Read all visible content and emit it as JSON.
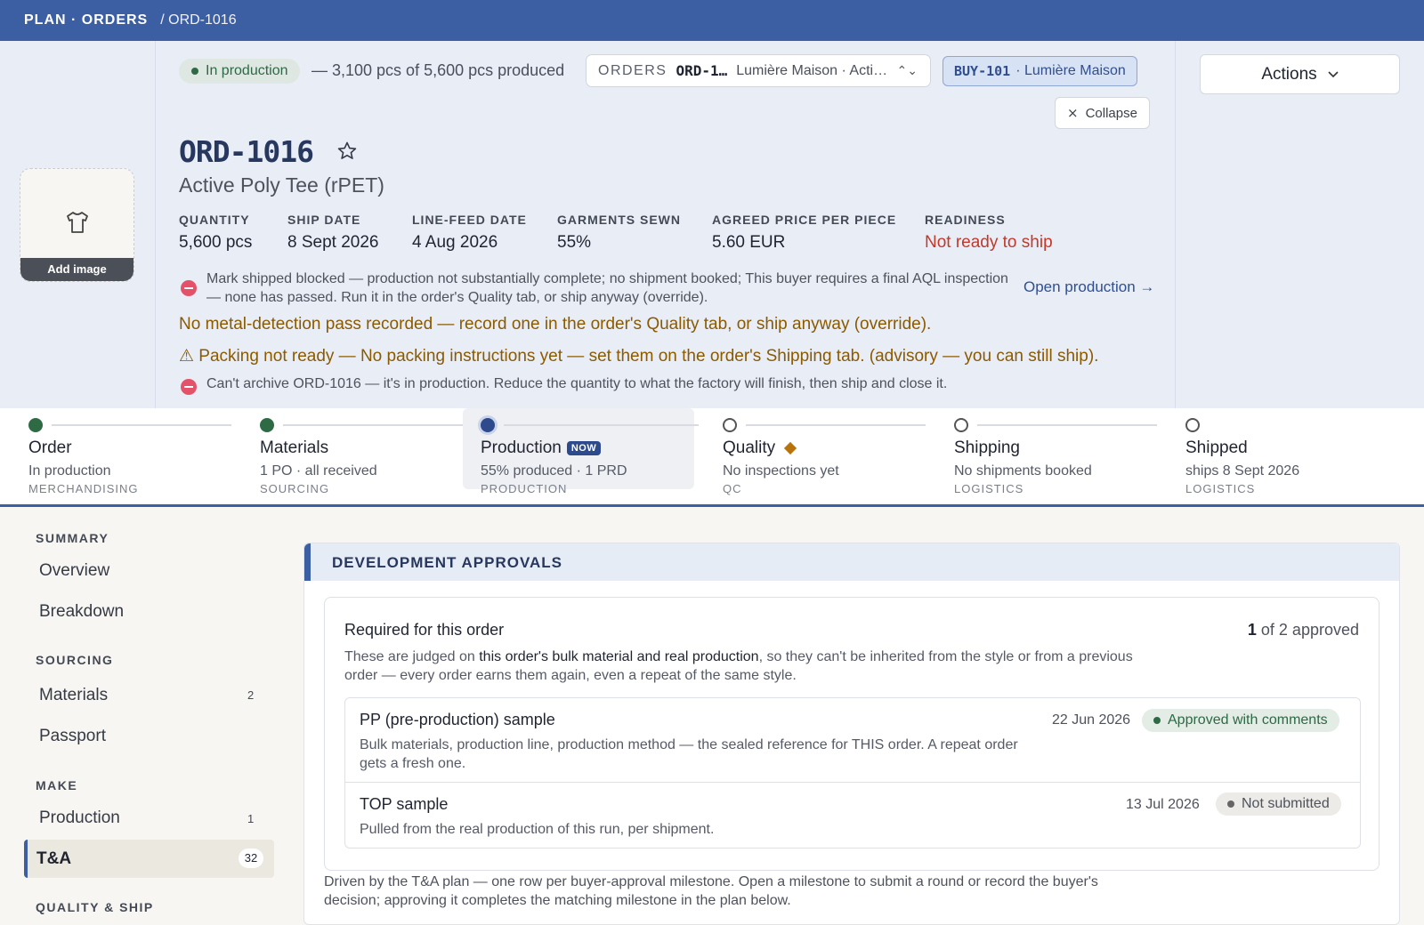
{
  "topbar": {
    "crumb1": "PLAN · ORDERS",
    "crumb2": "/ ORD-1016"
  },
  "header": {
    "status_pill": "In production",
    "produced_text": "— 3,100 pcs of 5,600 pcs produced",
    "orders_label": "ORDERS",
    "orders_code": "ORD-1…",
    "orders_who": "Lumière Maison · Acti…",
    "buyer_code": "BUY-101",
    "buyer_name": "· Lumière Maison",
    "collapse_label": "Collapse",
    "actions_label": "Actions",
    "add_image": "Add image",
    "order_id": "ORD-1016",
    "product": "Active Poly Tee (rPET)",
    "metrics": [
      {
        "k": "QUANTITY",
        "v": "5,600 pcs"
      },
      {
        "k": "SHIP DATE",
        "v": "8 Sept 2026"
      },
      {
        "k": "LINE-FEED DATE",
        "v": "4 Aug 2026"
      },
      {
        "k": "GARMENTS SEWN",
        "v": "55%"
      },
      {
        "k": "AGREED PRICE PER PIECE",
        "v": "5.60 EUR"
      },
      {
        "k": "READINESS",
        "v": "Not ready to ship"
      }
    ],
    "blocked_msg": "Mark shipped blocked — production not substantially complete; no shipment booked; This buyer requires a final AQL inspection — none has passed. Run it in the order's Quality tab, or ship anyway (override).",
    "open_production": "Open production →",
    "metal_warn": "No metal-detection pass recorded — record one in the order's Quality tab, or ship anyway (override).",
    "packing_warn": "⚠ Packing not ready — No packing instructions yet — set them on the order's Shipping tab. (advisory — you can still ship).",
    "archive_msg": "Can't archive ORD-1016 — it's in production. Reduce the quantity to what the factory will finish, then ship and close it."
  },
  "stepper": {
    "now_badge": "NOW",
    "steps": [
      {
        "name": "Order",
        "desc": "In production",
        "team": "MERCHANDISING",
        "state": "done"
      },
      {
        "name": "Materials",
        "desc": "1 PO · all received",
        "team": "SOURCING",
        "state": "done"
      },
      {
        "name": "Production",
        "desc": "55% produced · 1 PRD",
        "team": "PRODUCTION",
        "state": "current"
      },
      {
        "name": "Quality",
        "desc": "No inspections yet",
        "team": "QC",
        "state": "pending"
      },
      {
        "name": "Shipping",
        "desc": "No shipments booked",
        "team": "LOGISTICS",
        "state": "pending"
      },
      {
        "name": "Shipped",
        "desc": "ships 8 Sept 2026",
        "team": "LOGISTICS",
        "state": "pending"
      }
    ]
  },
  "sidenav": {
    "summary": "SUMMARY",
    "overview": "Overview",
    "breakdown": "Breakdown",
    "sourcing": "SOURCING",
    "materials": "Materials",
    "materials_count": "2",
    "passport": "Passport",
    "make": "MAKE",
    "production": "Production",
    "production_count": "1",
    "tna": "T&A",
    "tna_count": "32",
    "quality_ship": "QUALITY & SHIP"
  },
  "panel": {
    "title": "DEVELOPMENT APPROVALS",
    "card_title": "Required for this order",
    "count_num": "1",
    "count_rest": "of 2 approved",
    "intro_a": "These are judged on",
    "intro_b": "this order's bulk material and real production",
    "intro_c": ", so they can't be inherited from the style or from a previous order — every order earns them again, even a repeat of the same style.",
    "rows": [
      {
        "title": "PP (pre-production) sample",
        "desc": "Bulk materials, production line, production method — the sealed reference for THIS order. A repeat order gets a fresh one.",
        "date": "22 Jun 2026",
        "status": "Approved with comments"
      },
      {
        "title": "TOP sample",
        "desc": "Pulled from the real production of this run, per shipment.",
        "date": "13 Jul 2026",
        "status": "Not submitted"
      }
    ],
    "footer": "Driven by the T&A plan — one row per buyer-approval milestone. Open a milestone to submit a round or record the buyer's decision; approving it completes the matching milestone in the plan below."
  },
  "colors": {
    "accent": "#3c5ea3",
    "done": "#2e6b45",
    "warn": "#8a5a00",
    "danger": "#c0392b"
  }
}
